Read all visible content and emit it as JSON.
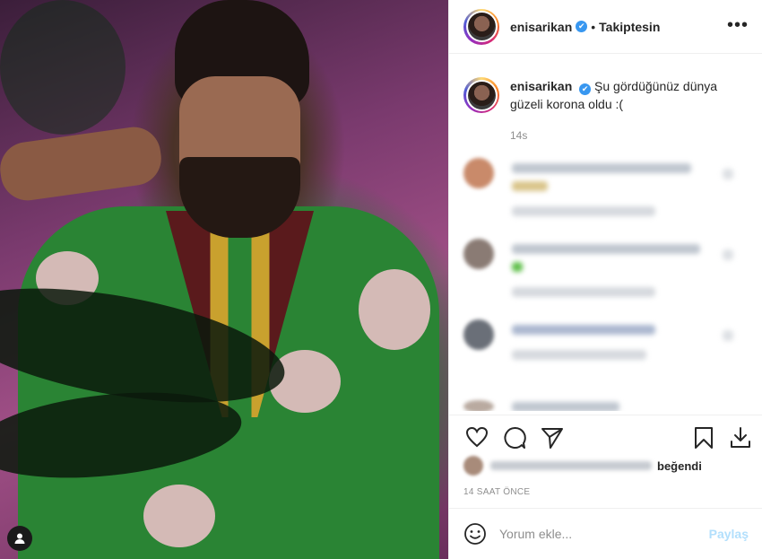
{
  "post": {
    "username": "enisarikan",
    "verified_glyph": "✔",
    "separator": "•",
    "follow_status": "Takiptesin",
    "more_glyph": "•••",
    "caption_text": "Şu gördüğünüz dünya güzeli korona oldu :(",
    "caption_age": "14s",
    "liked_by_suffix": "beğendi",
    "timestamp": "14 SAAT ÖNCE",
    "comment_placeholder": "Yorum ekle...",
    "post_button": "Paylaş"
  },
  "icons": {
    "header_more": "more-options-icon",
    "like": "heart-icon",
    "comment": "comment-bubble-icon",
    "share": "paper-plane-icon",
    "save": "bookmark-icon",
    "download": "download-icon",
    "emoji": "emoji-icon",
    "tag": "user-tag-icon"
  },
  "colors": {
    "verified": "#3897f0",
    "post_button_disabled": "#b2dffc",
    "muted_text": "#8e8e8e"
  }
}
